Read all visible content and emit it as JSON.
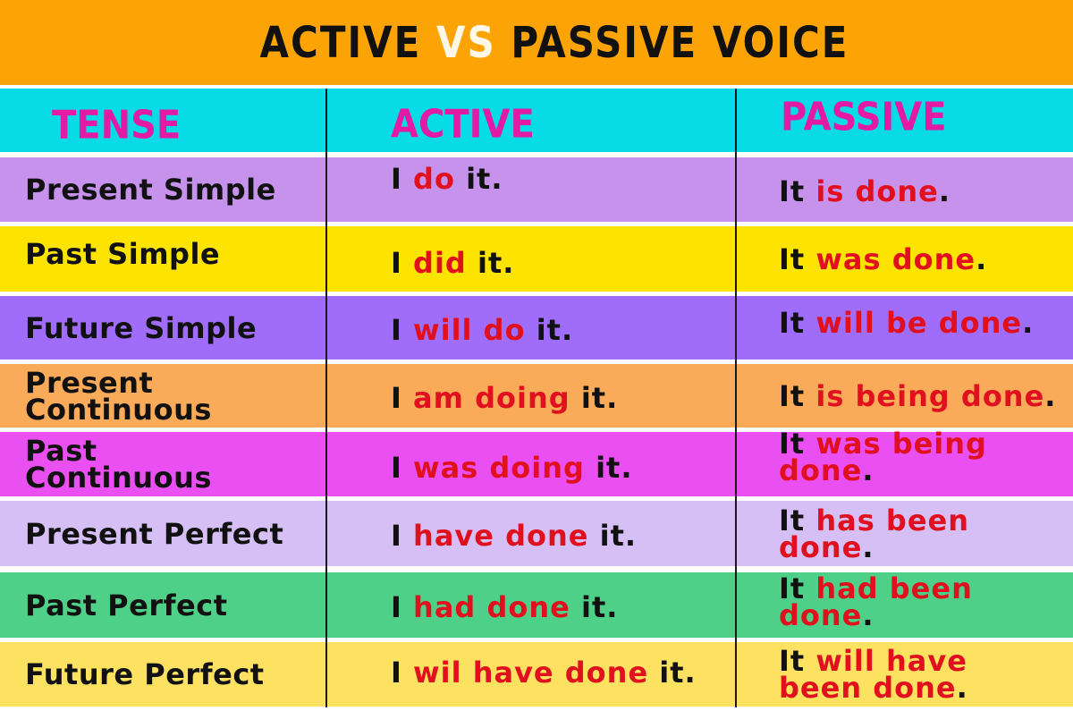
{
  "title": {
    "part1": "ACTIVE",
    "vs": "VS",
    "part2": "PASSIVE VOICE"
  },
  "colors": {
    "banner": "#fca406",
    "header_row": "#07dbe6",
    "header_text": "#e21aa4",
    "highlight_text": "#e0101e",
    "plain_text": "#111111"
  },
  "headers": {
    "tense": "TENSE",
    "active": "ACTIVE",
    "passive": "PASSIVE"
  },
  "rows": [
    {
      "tense": "Present Simple",
      "bg": "#c792ec",
      "active": {
        "pre": "I",
        "verb": "do",
        "post": "it."
      },
      "passive": {
        "pre": "It",
        "verb": "is done",
        "post": "."
      }
    },
    {
      "tense": "Past Simple",
      "bg": "#fce300",
      "active": {
        "pre": "I",
        "verb": "did",
        "post": "it."
      },
      "passive": {
        "pre": "It",
        "verb": "was done",
        "post": "."
      }
    },
    {
      "tense": "Future Simple",
      "bg": "#a06cfa",
      "active": {
        "pre": "I",
        "verb": "will do",
        "post": "it."
      },
      "passive": {
        "pre": "It",
        "verb": "will be done",
        "post": "."
      }
    },
    {
      "tense": "Present Continuous",
      "bg": "#f9ab5a",
      "active": {
        "pre": "I",
        "verb": "am doing",
        "post": "it."
      },
      "passive": {
        "pre": "It",
        "verb": "is being done",
        "post": "."
      }
    },
    {
      "tense": "Past Continuous",
      "bg": "#ea4ff2",
      "active": {
        "pre": "I",
        "verb": "was doing",
        "post": "it."
      },
      "passive": {
        "pre": "It",
        "verb": "was being done",
        "post": "."
      }
    },
    {
      "tense": "Present Perfect",
      "bg": "#d6bff4",
      "active": {
        "pre": "I",
        "verb": "have done",
        "post": "it."
      },
      "passive": {
        "pre": "It",
        "verb": "has been done",
        "post": "."
      }
    },
    {
      "tense": "Past Perfect",
      "bg": "#4fd088",
      "active": {
        "pre": "I",
        "verb": "had done",
        "post": "it."
      },
      "passive": {
        "pre": "It",
        "verb": "had been done",
        "post": "."
      }
    },
    {
      "tense": "Future Perfect",
      "bg": "#fde262",
      "active": {
        "pre": "I",
        "verb": "wil have done",
        "post": "it."
      },
      "passive": {
        "pre": "It",
        "verb": "will have been done",
        "post": "."
      }
    }
  ]
}
